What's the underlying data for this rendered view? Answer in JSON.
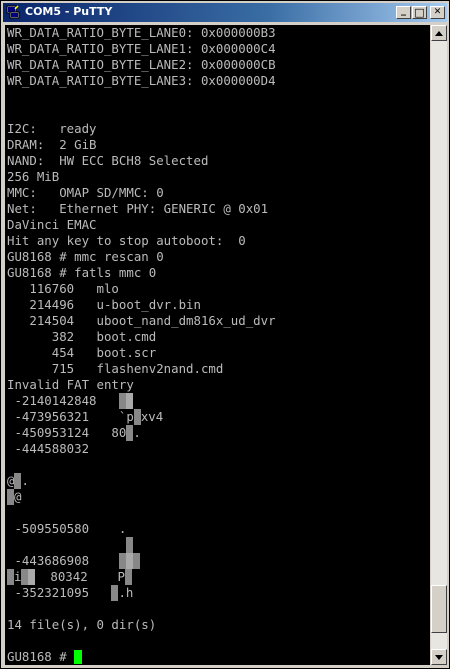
{
  "window": {
    "title": "COM5 - PuTTY"
  },
  "titlebar_buttons": {
    "minimize": "_",
    "maximize": "□",
    "close": "✕"
  },
  "icons": [
    "putty-app-icon",
    "scroll-up-arrow-icon",
    "scroll-down-arrow-icon"
  ],
  "colors": {
    "terminal_bg": "#000000",
    "terminal_fg": "#bbbbbb",
    "cursor": "#00ff00"
  },
  "terminal": {
    "lines": [
      "WR_DATA_RATIO_BYTE_LANE0: 0x000000B3",
      "WR_DATA_RATIO_BYTE_LANE1: 0x000000C4",
      "WR_DATA_RATIO_BYTE_LANE2: 0x000000CB",
      "WR_DATA_RATIO_BYTE_LANE3: 0x000000D4",
      "",
      "",
      "I2C:   ready",
      "DRAM:  2 GiB",
      "NAND:  HW ECC BCH8 Selected",
      "256 MiB",
      "MMC:   OMAP SD/MMC: 0",
      "Net:   Ethernet PHY: GENERIC @ 0x01",
      "DaVinci EMAC",
      "Hit any key to stop autoboot:  0",
      "GU8168 # mmc rescan 0",
      "GU8168 # fatls mmc 0",
      "   116760   mlo",
      "   214496   u-boot_dvr.bin",
      "   214504   uboot_nand_dm816x_ud_dvr",
      "      382   boot.cmd",
      "      454   boot.scr",
      "      715   flashenv2nand.cmd",
      "Invalid FAT entry",
      " -2140142848",
      " -473956321    `p",
      " -450953124   80",
      " -444588032",
      "",
      "",
      "",
      "",
      " -509550580    .",
      "",
      " -443686908",
      "  80342    P",
      " -352321095",
      "",
      "14 file(s), 0 dir(s)",
      "",
      "GU8168 # "
    ],
    "garbled_fragments": {
      "xv4": "xv4",
      "dot1": ".",
      "at_dot": "@",
      "at_dot2": ".",
      "at2": "@",
      "i": "i",
      "h": ".h"
    }
  }
}
